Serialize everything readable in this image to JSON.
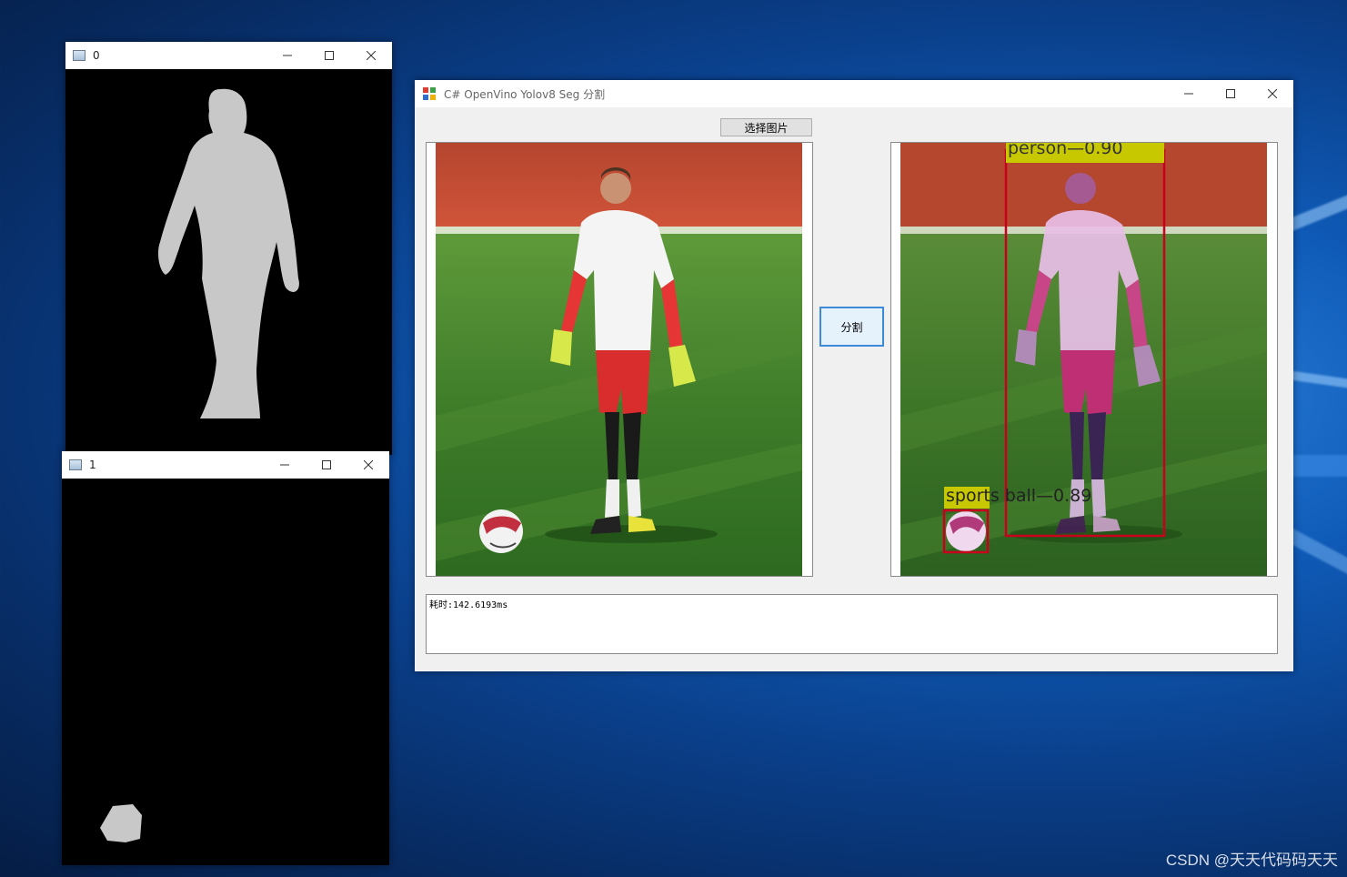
{
  "colors": {
    "desktop_accent": "#0f5bb8",
    "mask_fill": "#c8c8c8",
    "box_red": "#c8001e",
    "label_bg": "#c8c800",
    "button_focus": "#3c8ad8"
  },
  "mask_windows": [
    {
      "title": "0",
      "icon": "app-window-icon"
    },
    {
      "title": "1",
      "icon": "app-window-icon"
    }
  ],
  "main_window": {
    "title": "C# OpenVino Yolov8 Seg 分割",
    "icon": "winforms-app-icon",
    "choose_image_button": "选择图片",
    "segment_button": "分割",
    "log_text": "耗时:142.6193ms",
    "detections": [
      {
        "label": "person—0.90"
      },
      {
        "label": "sports  ball—0.89"
      }
    ]
  },
  "window_controls": {
    "minimize": "minimize-icon",
    "maximize": "maximize-icon",
    "close": "close-icon"
  },
  "watermark": "CSDN @天天代码码天天"
}
